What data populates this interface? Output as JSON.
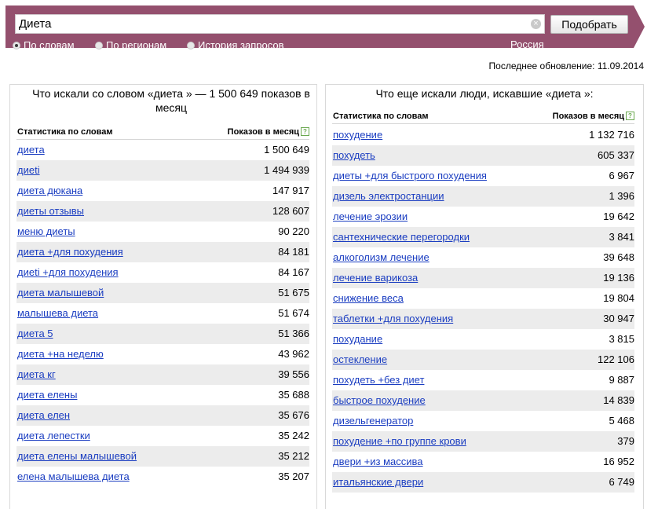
{
  "search": {
    "value": "Диета",
    "clear_glyph": "×",
    "submit_label": "Подобрать"
  },
  "modes": [
    {
      "label": "По словам",
      "selected": true
    },
    {
      "label": "По регионам",
      "selected": false
    },
    {
      "label": "История запросов",
      "selected": false
    }
  ],
  "region": "Россия",
  "last_update": "Последнее обновление: 11.09.2014",
  "colors": {
    "topbar": "#94506e",
    "link": "#1a3dc1",
    "stripe": "#ececec"
  },
  "left": {
    "title": "Что искали со словом «диета » — 1 500 649 показов в месяц",
    "col_phrase": "Статистика по словам",
    "col_count": "Показов в месяц",
    "help": "?",
    "rows": [
      {
        "phrase": "диета",
        "count": "1 500 649"
      },
      {
        "phrase": "диеti",
        "count": "1 494 939"
      },
      {
        "phrase": "диета дюкана",
        "count": "147 917"
      },
      {
        "phrase": "диеты отзывы",
        "count": "128 607"
      },
      {
        "phrase": "меню диеты",
        "count": "90 220"
      },
      {
        "phrase": "диета +для похудения",
        "count": "84 181"
      },
      {
        "phrase": "диеti +для похудения",
        "count": "84 167"
      },
      {
        "phrase": "диета малышевой",
        "count": "51 675"
      },
      {
        "phrase": "малышева диета",
        "count": "51 674"
      },
      {
        "phrase": "диета 5",
        "count": "51 366"
      },
      {
        "phrase": "диета +на неделю",
        "count": "43 962"
      },
      {
        "phrase": "диета кг",
        "count": "39 556"
      },
      {
        "phrase": "диета елены",
        "count": "35 688"
      },
      {
        "phrase": "диета елен",
        "count": "35 676"
      },
      {
        "phrase": "диета лепестки",
        "count": "35 242"
      },
      {
        "phrase": "диета елены малышевой",
        "count": "35 212"
      },
      {
        "phrase": "елена малышева диета",
        "count": "35 207"
      }
    ]
  },
  "right": {
    "title": "Что еще искали люди, искавшие «диета »:",
    "col_phrase": "Статистика по словам",
    "col_count": "Показов в месяц",
    "help": "?",
    "rows": [
      {
        "phrase": "похудение",
        "count": "1 132 716"
      },
      {
        "phrase": "похудеть",
        "count": "605 337"
      },
      {
        "phrase": "диеты +для быстрого похудения",
        "count": "6 967"
      },
      {
        "phrase": "дизель электростанции",
        "count": "1 396"
      },
      {
        "phrase": "лечение эрозии",
        "count": "19 642"
      },
      {
        "phrase": "сантехнические перегородки",
        "count": "3 841"
      },
      {
        "phrase": "алкоголизм лечение",
        "count": "39 648"
      },
      {
        "phrase": "лечение варикоза",
        "count": "19 136"
      },
      {
        "phrase": "снижение веса",
        "count": "19 804"
      },
      {
        "phrase": "таблетки +для похудения",
        "count": "30 947"
      },
      {
        "phrase": "похудание",
        "count": "3 815"
      },
      {
        "phrase": "остекление",
        "count": "122 106"
      },
      {
        "phrase": "похудеть +без диет",
        "count": "9 887"
      },
      {
        "phrase": "быстрое похудение",
        "count": "14 839"
      },
      {
        "phrase": "дизельгенератор",
        "count": "5 468"
      },
      {
        "phrase": "похудение +по группе крови",
        "count": "379"
      },
      {
        "phrase": "двери +из массива",
        "count": "16 952"
      },
      {
        "phrase": "итальянские двери",
        "count": "6 749"
      }
    ]
  }
}
